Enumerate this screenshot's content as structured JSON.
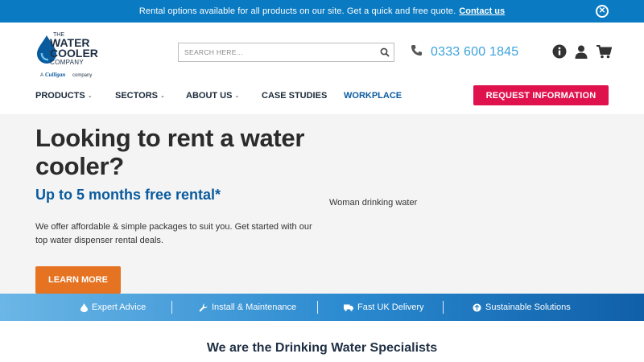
{
  "banner": {
    "message": "Rental options available for all products on our site. Get a quick and free quote.",
    "link": "Contact us",
    "close_icon": "close-icon"
  },
  "logo": {
    "line1": "THE",
    "line2": "WATER",
    "line3": "COOLER",
    "line4": "COMPANY",
    "tag_a": "A",
    "tag_brand": "Culligan",
    "tag_company": "company"
  },
  "search": {
    "placeholder": "SEARCH HERE...",
    "icon": "search-icon"
  },
  "phone": {
    "number": "0333 600 1845",
    "icon": "phone-icon"
  },
  "header_icons": [
    "info-icon",
    "user-icon",
    "cart-icon"
  ],
  "nav": {
    "products": "PRODUCTS",
    "sectors": "SECTORS",
    "about": "ABOUT US",
    "case_studies": "CASE STUDIES",
    "workplace": "WORKPLACE",
    "request": "REQUEST INFORMATION"
  },
  "hero": {
    "title": "Looking to rent a water cooler?",
    "subtitle": "Up to 5 months free rental*",
    "body": "We offer affordable & simple packages to suit you. Get started with our top water dispenser rental deals.",
    "image_alt": "Woman drinking water",
    "button": "LEARN MORE"
  },
  "features": [
    {
      "label": "Expert Advice",
      "icon": "water-drop-icon"
    },
    {
      "label": "Install & Maintenance",
      "icon": "wrench-icon"
    },
    {
      "label": "Fast UK Delivery",
      "icon": "truck-icon"
    },
    {
      "label": "Sustainable Solutions",
      "icon": "recycle-icon"
    }
  ],
  "section_heading": "We are the Drinking Water Specialists",
  "colors": {
    "banner": "#0a7bc2",
    "request_button": "#e0124d",
    "learn_button": "#e57322",
    "brand_blue": "#0a5b9e",
    "phone": "#3aa3de"
  }
}
